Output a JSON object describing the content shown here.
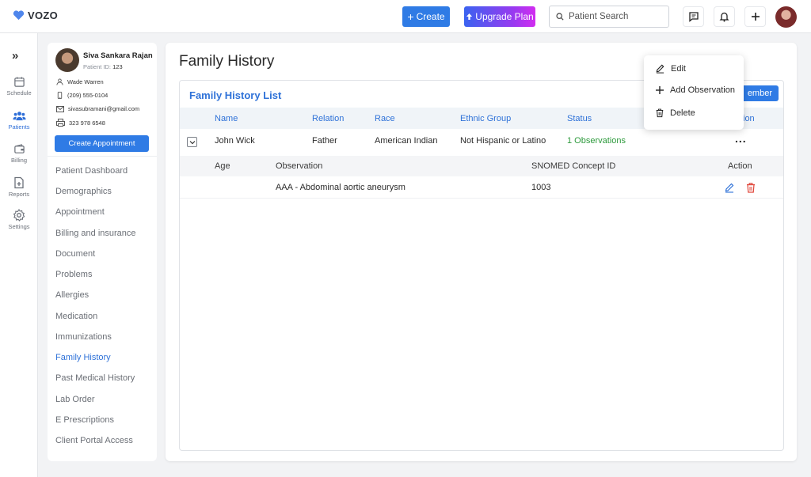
{
  "app": {
    "logo_text": "VOZO"
  },
  "topbar": {
    "create_label": "Create",
    "upgrade_label": "Upgrade Plan",
    "search_placeholder": "Patient Search"
  },
  "rail": {
    "items": [
      {
        "label": "Schedule",
        "icon": "calendar-icon"
      },
      {
        "label": "Patients",
        "icon": "users-icon",
        "active": true
      },
      {
        "label": "Billing",
        "icon": "wallet-icon"
      },
      {
        "label": "Reports",
        "icon": "report-icon"
      },
      {
        "label": "Settings",
        "icon": "gear-icon"
      }
    ]
  },
  "patient": {
    "name": "Siva Sankara Rajan",
    "id_label": "Patient ID:",
    "id_value": "123",
    "provider": "Wade Warren",
    "phone": "(209) 555-0104",
    "email": "sivasubramani@gmail.com",
    "fax": "323 978 6548",
    "create_appointment": "Create Appointment"
  },
  "nav": {
    "items": [
      "Patient Dashboard",
      "Demographics",
      "Appointment",
      "Billing and insurance",
      "Document",
      "Problems",
      "Allergies",
      "Medication",
      "Immunizations",
      "Family History",
      "Past Medical History",
      "Lab Order",
      "E Prescriptions",
      "Client Portal Access"
    ],
    "active": "Family History"
  },
  "main": {
    "title": "Family History",
    "list_title": "Family History List",
    "add_button_visible": "ember",
    "columns": {
      "name": "Name",
      "relation": "Relation",
      "race": "Race",
      "ethnic_group": "Ethnic Group",
      "status": "Status",
      "action_visible": "ion"
    },
    "row": {
      "name": "John Wick",
      "relation": "Father",
      "race": "American Indian",
      "ethnic_group": "Not Hispanic or Latino",
      "status": "1 Observations",
      "more": "..."
    },
    "sub_columns": {
      "age": "Age",
      "observation": "Observation",
      "snomed": "SNOMED Concept ID",
      "action": "Action"
    },
    "sub_row": {
      "age": "",
      "observation": "AAA - Abdominal aortic aneurysm",
      "snomed": "1003"
    }
  },
  "menu": {
    "edit": "Edit",
    "add_observation": "Add Observation",
    "delete": "Delete"
  },
  "colors": {
    "accent": "#2f7be5",
    "status_green": "#2d9a3c",
    "delete_red": "#e0463a"
  }
}
